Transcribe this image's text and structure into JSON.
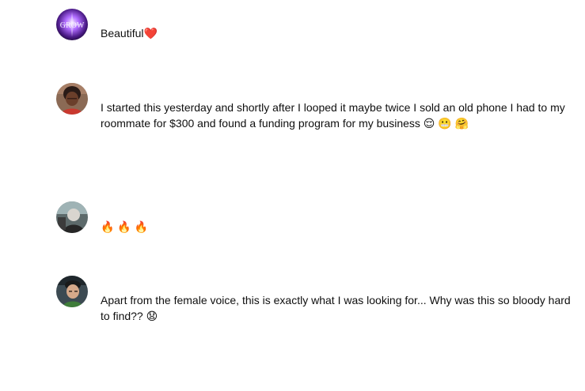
{
  "comments": [
    {
      "avatar_icon": "grow-logo-avatar",
      "avatar_text": "GROW",
      "text": "Beautiful❤️"
    },
    {
      "avatar_icon": "user-photo-avatar",
      "text": "I started this yesterday and shortly after I looped it maybe twice I sold an old phone I had to my roommate for $300 and found a funding program for my business 😌 😬 🤗"
    },
    {
      "avatar_icon": "user-photo-avatar",
      "text": "🔥 🔥 🔥"
    },
    {
      "avatar_icon": "user-photo-avatar",
      "text": "Apart from the female voice, this is exactly what I was looking for... Why was this so bloody hard to find?? 😧"
    }
  ],
  "colors": {
    "text": "#0f0f0f",
    "background": "#ffffff"
  }
}
